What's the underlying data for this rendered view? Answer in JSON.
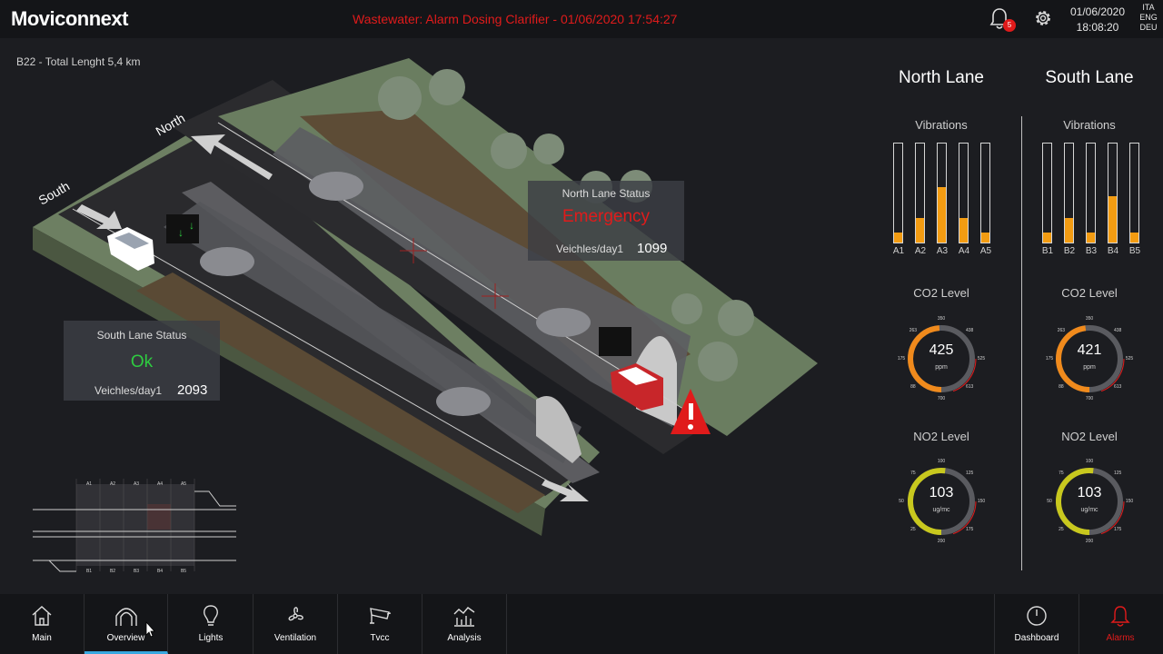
{
  "header": {
    "logo": "Moviconnext",
    "alarm_message": "Wastewater: Alarm Dosing Clarifier - 01/06/2020 17:54:27",
    "notification_count": "5",
    "date": "01/06/2020",
    "time": "18:08:20",
    "languages": [
      "ITA",
      "ENG",
      "DEU"
    ]
  },
  "tunnel": {
    "info": "B22 - Total Lenght 5,4 km",
    "label_north": "North",
    "label_south": "South",
    "north_status": {
      "title": "North Lane Status",
      "value": "Emergency",
      "count_label": "Veichles/day1",
      "count": "1099",
      "color": "#e01b1b"
    },
    "south_status": {
      "title": "South Lane Status",
      "value": "Ok",
      "count_label": "Veichles/day1",
      "count": "2093",
      "color": "#2ecc40"
    },
    "minimap_sections": [
      "A1",
      "A2",
      "A3",
      "A4",
      "A5"
    ],
    "minimap_sections_bottom": [
      "B1",
      "B2",
      "B3",
      "B4",
      "B5"
    ]
  },
  "lanes": {
    "north": {
      "title": "North Lane",
      "vibrations_label": "Vibrations",
      "vibrations": [
        {
          "label": "A1",
          "level": 0.1
        },
        {
          "label": "A2",
          "level": 0.25
        },
        {
          "label": "A3",
          "level": 0.56
        },
        {
          "label": "A4",
          "level": 0.25
        },
        {
          "label": "A5",
          "level": 0.1
        }
      ],
      "co2": {
        "label": "CO2 Level",
        "value": "425",
        "unit": "ppm",
        "fraction": 0.49,
        "ticks": [
          "88",
          "175",
          "263",
          "350",
          "438",
          "525",
          "613",
          "700"
        ]
      },
      "no2": {
        "label": "NO2 Level",
        "value": "103",
        "unit": "ug/mc",
        "fraction": 0.52,
        "ticks": [
          "25",
          "50",
          "75",
          "100",
          "125",
          "150",
          "175",
          "200"
        ]
      }
    },
    "south": {
      "title": "South Lane",
      "vibrations_label": "Vibrations",
      "vibrations": [
        {
          "label": "B1",
          "level": 0.1
        },
        {
          "label": "B2",
          "level": 0.25
        },
        {
          "label": "B3",
          "level": 0.1
        },
        {
          "label": "B4",
          "level": 0.47
        },
        {
          "label": "B5",
          "level": 0.1
        }
      ],
      "co2": {
        "label": "CO2 Level",
        "value": "421",
        "unit": "ppm",
        "fraction": 0.48,
        "ticks": [
          "88",
          "175",
          "263",
          "350",
          "438",
          "525",
          "613",
          "700"
        ]
      },
      "no2": {
        "label": "NO2 Level",
        "value": "103",
        "unit": "ug/mc",
        "fraction": 0.52,
        "ticks": [
          "25",
          "50",
          "75",
          "100",
          "125",
          "150",
          "175",
          "200"
        ]
      }
    }
  },
  "colors": {
    "accent": "#38a8e0",
    "alarm": "#e01b1b",
    "ok": "#2ecc40",
    "co2_arc": "#f08a1c",
    "no2_arc": "#c8c81e",
    "bar_fill": "#f39c12"
  },
  "nav": [
    {
      "label": "Main",
      "icon": "home-icon"
    },
    {
      "label": "Overview",
      "icon": "tunnel-icon"
    },
    {
      "label": "Lights",
      "icon": "bulb-icon"
    },
    {
      "label": "Ventilation",
      "icon": "fan-icon"
    },
    {
      "label": "Tvcc",
      "icon": "camera-icon"
    },
    {
      "label": "Analysis",
      "icon": "chart-icon"
    },
    {
      "label": "Dashboard",
      "icon": "dashboard-icon"
    },
    {
      "label": "Alarms",
      "icon": "bell-icon"
    }
  ]
}
